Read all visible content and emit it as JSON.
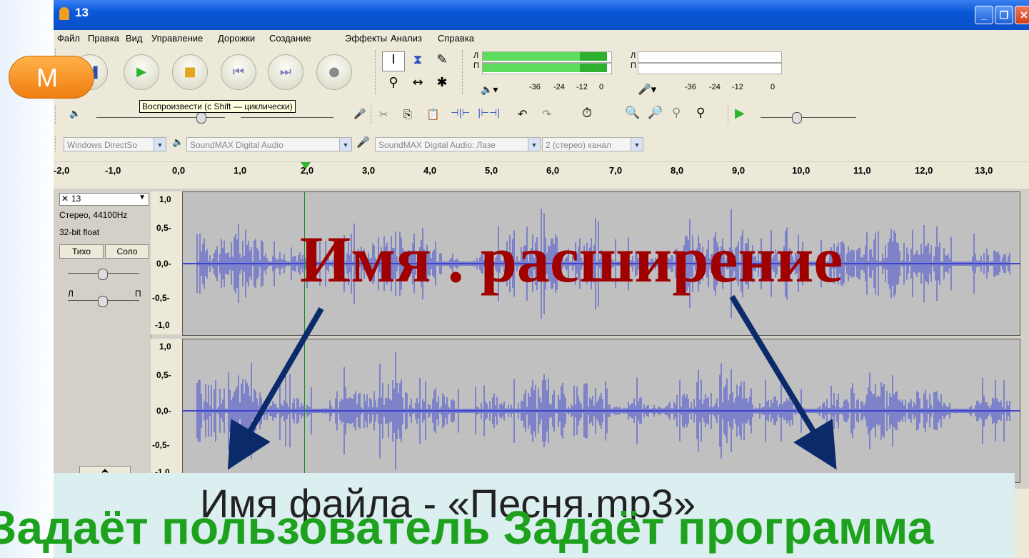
{
  "window": {
    "title": "13"
  },
  "menu": [
    "Файл",
    "Правка",
    "Вид",
    "Управление",
    "Дорожки",
    "Создание",
    "Эффекты",
    "Анализ",
    "Справка"
  ],
  "orange_button_letter": "М",
  "tooltip": "Воспроизвести (с Shift — циклически)",
  "meters": {
    "playback_L": "Л",
    "playback_R": "П",
    "record_L": "Л",
    "record_R": "П",
    "scale_play": [
      "-36",
      "-24",
      "-12",
      "0"
    ],
    "scale_rec": [
      "-36",
      "-24",
      "-12",
      "0"
    ]
  },
  "devices": {
    "host": "Windows DirectSo",
    "output": "SoundMAX Digital Audio",
    "input": "SoundMAX Digital Audio: Лазе",
    "channels": "2 (стерео) канал"
  },
  "ruler": [
    "-2,0",
    "-1,0",
    "0,0",
    "1,0",
    "2,0",
    "3,0",
    "4,0",
    "5,0",
    "6,0",
    "7,0",
    "8,0",
    "9,0",
    "10,0",
    "11,0",
    "12,0",
    "13,0"
  ],
  "track": {
    "name": "13",
    "info1": "Стерео, 44100Hz",
    "info2": "32-bit float",
    "mute": "Тихо",
    "solo": "Соло",
    "pan_L": "Л",
    "pan_R": "П",
    "scale": [
      "1,0",
      "0,5-",
      "0,0-",
      "-0,5-",
      "-1,0"
    ],
    "scale2": [
      "1,0",
      "0,5-",
      "0,0-",
      "-0,5-",
      "-1,0"
    ]
  },
  "overlay": {
    "title": "Имя . расширение",
    "caption": "Имя файла - «Песня.mp3»",
    "green_text": "Задаёт пользователь  Задаёт программа"
  },
  "colors": {
    "title_red": "#a00000",
    "green": "#1ea21e",
    "waveform": "#3c44d0"
  }
}
